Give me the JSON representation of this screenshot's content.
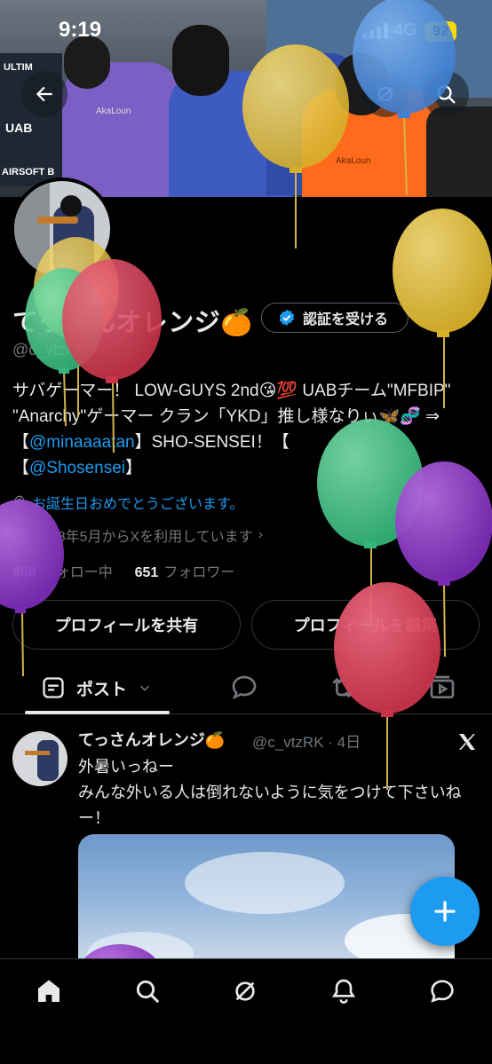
{
  "status": {
    "time": "9:19",
    "network": "4G",
    "battery": "92"
  },
  "banner": {
    "labels": [
      "ULTIM",
      "UAB",
      "AIRSOFT B",
      "AkaLoun",
      "AkaLoun"
    ]
  },
  "profile": {
    "name": "てっさんオレンジ🍊",
    "verify_label": "認証を受ける",
    "handle": "@c_vtzRK",
    "bio_part1": "サバゲーマー！ LOW-GUYS 2nd😘💯 UABチーム\"MFBIP\" \"Anarchy\"ゲーマー クラン「YKD」推し様なりぃ🦋🧬 ⇒【",
    "bio_link1": "@minaaaatan",
    "bio_part2": "】SHO-SENSEI！【",
    "bio_link2": "@Shosensei",
    "bio_part3": "】",
    "birthday": "お誕生日おめでとうございます。",
    "joined": "2018年5月からXを利用しています",
    "following_count": "858",
    "following_label": "フォロー中",
    "followers_count": "651",
    "followers_label": "フォロワー",
    "share_label": "プロフィールを共有",
    "edit_label": "プロフィールを編集"
  },
  "tabs": {
    "posts_label": "ポスト"
  },
  "post": {
    "name": "てっさんオレンジ🍊",
    "handle_time": "@c_vtzRK · 4日",
    "line1": "外暑いっねー",
    "line2": "みんな外いる人は倒れないように気をつけて下さいねー！"
  },
  "colors": {
    "accent": "#1d9bf0",
    "background": "#000000",
    "text": "#e7e9ea",
    "muted": "#71767b"
  },
  "icons": [
    "back-arrow-icon",
    "grok-icon",
    "search-icon",
    "verified-badge-icon",
    "location-icon",
    "calendar-icon",
    "post-tab-icon",
    "reply-icon",
    "repost-icon",
    "media-icon",
    "x-logo-icon",
    "plus-icon",
    "home-icon",
    "explore-icon",
    "grok-nav-icon",
    "notifications-icon",
    "messages-icon"
  ]
}
